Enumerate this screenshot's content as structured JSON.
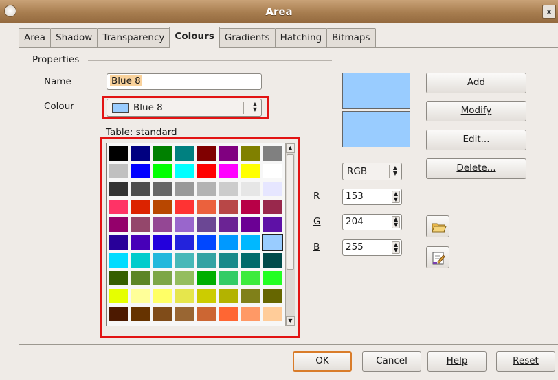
{
  "window": {
    "title": "Area",
    "close_glyph": "x"
  },
  "tabs": [
    {
      "label": "Area"
    },
    {
      "label": "Shadow"
    },
    {
      "label": "Transparency"
    },
    {
      "label": "Colours"
    },
    {
      "label": "Gradients"
    },
    {
      "label": "Hatching"
    },
    {
      "label": "Bitmaps"
    }
  ],
  "active_tab": "Colours",
  "properties": {
    "group_label": "Properties",
    "name_label": "Name",
    "name_value": "Blue 8",
    "colour_label": "Colour",
    "colour_value": "Blue 8",
    "colour_swatch": "#99ccff",
    "table_label": "Table: standard"
  },
  "palette": [
    [
      "#000000",
      "#000080",
      "#008000",
      "#008080",
      "#800000",
      "#800080",
      "#808000",
      "#808080"
    ],
    [
      "#c0c0c0",
      "#0000ff",
      "#00ff00",
      "#00ffff",
      "#ff0000",
      "#ff00ff",
      "#ffff00",
      "#ffffff"
    ],
    [
      "#333333",
      "#4d4d4d",
      "#666666",
      "#999999",
      "#b3b3b3",
      "#cccccc",
      "#e6e6e6",
      "#e6e6ff"
    ],
    [
      "#ff3366",
      "#dc2300",
      "#b84700",
      "#ff3333",
      "#eb613d",
      "#b84747",
      "#b80047",
      "#99284c"
    ],
    [
      "#94006b",
      "#94476b",
      "#944794",
      "#9966cc",
      "#6b4794",
      "#6b2394",
      "#6b0094",
      "#5e11a6"
    ],
    [
      "#280099",
      "#4700b8",
      "#2300dc",
      "#2323dc",
      "#0047ff",
      "#0099ff",
      "#00b8ff",
      "#99ccff"
    ],
    [
      "#00dcff",
      "#00cccc",
      "#23b8dc",
      "#47b8b8",
      "#33a3a3",
      "#198a8a",
      "#006b6b",
      "#004a4a"
    ],
    [
      "#355e00",
      "#5c8526",
      "#7da647",
      "#94bd5e",
      "#00ae00",
      "#33cc66",
      "#3deb3d",
      "#23ff23"
    ],
    [
      "#e6ff00",
      "#ffff99",
      "#ffff66",
      "#e6e64c",
      "#cccc00",
      "#b3b300",
      "#808019",
      "#666600"
    ],
    [
      "#4c1900",
      "#663300",
      "#804c19",
      "#996633",
      "#cc6633",
      "#ff6633",
      "#ff9966",
      "#ffcc99"
    ]
  ],
  "selected_index": [
    5,
    7
  ],
  "preview_colours": [
    "#99ccff",
    "#99ccff"
  ],
  "color_model": "RGB",
  "rgb": {
    "r_label": "R",
    "r_value": "153",
    "g_label": "G",
    "g_value": "204",
    "b_label": "B",
    "b_value": "255"
  },
  "side_buttons": {
    "add": "Add",
    "modify": "Modify",
    "edit": "Edit...",
    "delete": "Delete..."
  },
  "footer": {
    "ok": "OK",
    "cancel": "Cancel",
    "help": "Help",
    "reset": "Reset"
  }
}
